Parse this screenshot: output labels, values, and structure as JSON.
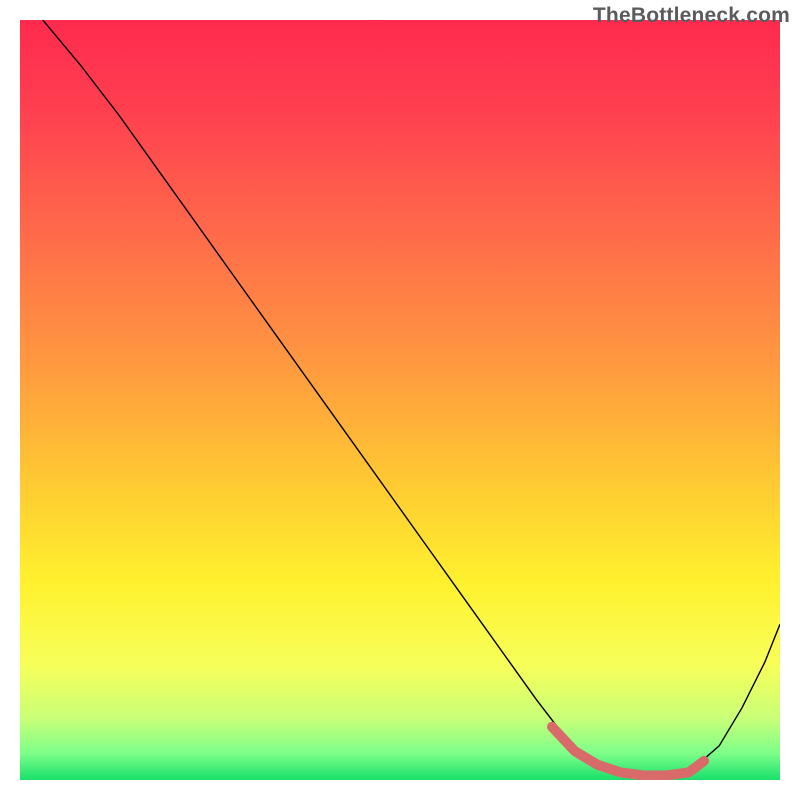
{
  "watermark": "TheBottleneck.com",
  "chart_data": {
    "type": "line",
    "title": "",
    "xlabel": "",
    "ylabel": "",
    "xlim": [
      0,
      100
    ],
    "ylim": [
      0,
      100
    ],
    "grid": false,
    "legend": false,
    "background_gradient": {
      "stops": [
        {
          "pos": 0.0,
          "color": "#ff2a4e"
        },
        {
          "pos": 0.12,
          "color": "#ff4050"
        },
        {
          "pos": 0.28,
          "color": "#ff6a4a"
        },
        {
          "pos": 0.45,
          "color": "#ff9840"
        },
        {
          "pos": 0.6,
          "color": "#ffc733"
        },
        {
          "pos": 0.74,
          "color": "#fff12e"
        },
        {
          "pos": 0.85,
          "color": "#f7ff5a"
        },
        {
          "pos": 0.92,
          "color": "#c7ff78"
        },
        {
          "pos": 0.965,
          "color": "#7dff8a"
        },
        {
          "pos": 1.0,
          "color": "#18e06a"
        }
      ]
    },
    "series": [
      {
        "name": "bottleneck-curve",
        "stroke": "#000000",
        "stroke_width": 1.4,
        "x": [
          3,
          8,
          13,
          18,
          23,
          28,
          33,
          38,
          43,
          48,
          53,
          58,
          63,
          68,
          72,
          76,
          80,
          84,
          88,
          92,
          95,
          98,
          100
        ],
        "y": [
          100,
          94,
          87.5,
          80.5,
          73.5,
          66.5,
          59.5,
          52.5,
          45.5,
          38.5,
          31.5,
          24.5,
          17.5,
          10.5,
          5.3,
          2.0,
          0.7,
          0.5,
          1.0,
          4.5,
          9.5,
          15.5,
          20.5
        ]
      },
      {
        "name": "optimal-zone-highlight",
        "stroke": "#d86a6a",
        "stroke_width": 10,
        "linecap": "round",
        "x": [
          70,
          73,
          76,
          79,
          82,
          85,
          88,
          90
        ],
        "y": [
          7.0,
          3.8,
          2.0,
          1.0,
          0.6,
          0.6,
          1.0,
          2.5
        ]
      }
    ]
  }
}
